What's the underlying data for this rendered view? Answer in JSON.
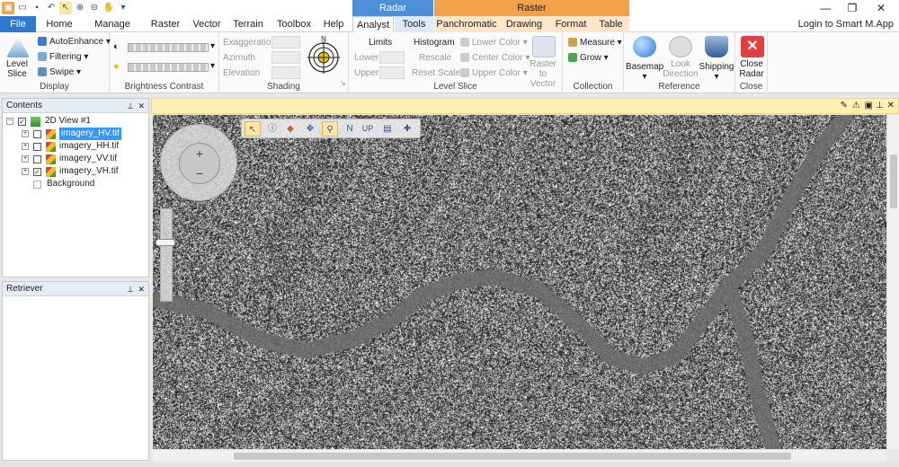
{
  "titlebar": {
    "context_radar": "Radar",
    "context_raster": "Raster",
    "window_controls": [
      "minimize-icon",
      "restore-icon",
      "close-icon"
    ]
  },
  "tabs": [
    {
      "label": "File"
    },
    {
      "label": "Home"
    },
    {
      "label": "Manage Data"
    },
    {
      "label": "Raster"
    },
    {
      "label": "Vector"
    },
    {
      "label": "Terrain"
    },
    {
      "label": "Toolbox"
    },
    {
      "label": "Help"
    },
    {
      "label": "Analyst"
    },
    {
      "label": "Tools"
    },
    {
      "label": "Panchromatic"
    },
    {
      "label": "Drawing"
    },
    {
      "label": "Format"
    },
    {
      "label": "Table"
    }
  ],
  "login": "Login to Smart M.App",
  "ribbon": {
    "display": {
      "label": "Display",
      "level_slice": "Level\nSlice",
      "auto_enhance": "AutoEnhance",
      "filtering": "Filtering",
      "swipe": "Swipe"
    },
    "brightness_contrast": {
      "label": "Brightness Contrast"
    },
    "shading": {
      "label": "Shading",
      "exaggeration": "Exaggeration",
      "azimuth": "Azimuth",
      "elevation": "Elevation",
      "compass_n": "N"
    },
    "level_slice": {
      "label": "Level Slice",
      "limits": "Limits",
      "lower": "Lower",
      "upper": "Upper",
      "histogram": "Histogram",
      "rescale": "Rescale",
      "reset_scale": "Reset Scale",
      "lower_color": "Lower Color",
      "center_color": "Center Color",
      "upper_color": "Upper Color",
      "raster_to_vector": "Raster to\nVector"
    },
    "collection": {
      "label": "Collection",
      "measure": "Measure",
      "grow": "Grow"
    },
    "reference": {
      "label": "Reference",
      "basemap": "Basemap",
      "look_direction": "Look\nDirection",
      "shipping": "Shipping"
    },
    "close": {
      "label": "Close",
      "close_radar": "Close\nRadar"
    }
  },
  "contents": {
    "title": "Contents",
    "root": "2D View #1",
    "layers": [
      {
        "name": "imagery_HV.tif",
        "checked": false,
        "selected": true
      },
      {
        "name": "imagery_HH.tif",
        "checked": false,
        "selected": false
      },
      {
        "name": "imagery_VV.tif",
        "checked": false,
        "selected": false
      },
      {
        "name": "imagery_VH.tif",
        "checked": true,
        "selected": false
      }
    ],
    "background": "Background"
  },
  "retriever": {
    "title": "Retriever"
  },
  "map": {
    "toolbar_icons": [
      "select-arrow-icon",
      "info-icon",
      "eraser-icon",
      "pan-icon",
      "zoom-icon",
      "north-icon",
      "up-icon",
      "fit-icon",
      "crosshair-icon"
    ],
    "north_label": "N",
    "up_label": "UP",
    "nav_zoom_in": "+",
    "nav_zoom_out": "−"
  }
}
